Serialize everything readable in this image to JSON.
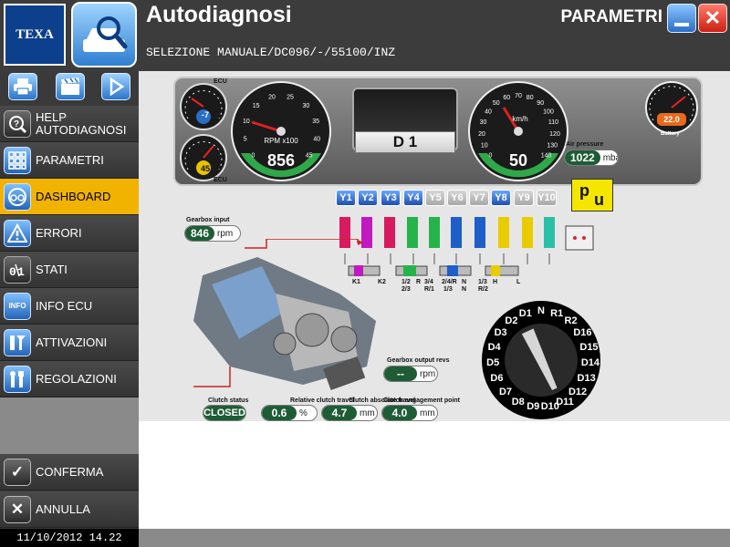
{
  "header": {
    "brand": "TEXA",
    "title": "Autodiagnosi",
    "path": "SELEZIONE MANUALE/DC096/-/55100/INZ",
    "section": "PARAMETRI"
  },
  "sidebar": {
    "toolbar": [
      "printer-icon",
      "clapper-icon",
      "play-icon"
    ],
    "items": [
      {
        "line1": "HELP",
        "line2": "AUTODIAGNOSI",
        "icon": "help-icon"
      },
      {
        "label": "PARAMETRI",
        "icon": "grid-icon"
      },
      {
        "label": "DASHBOARD",
        "icon": "dashboard-icon",
        "active": true
      },
      {
        "label": "ERRORI",
        "icon": "warning-icon"
      },
      {
        "label": "STATI",
        "icon": "switch-icon"
      },
      {
        "label": "INFO ECU",
        "icon": "info-icon",
        "badge": "INFO"
      },
      {
        "label": "ATTIVAZIONI",
        "icon": "activation-icon"
      },
      {
        "label": "REGOLAZIONI",
        "icon": "tools-icon"
      }
    ],
    "confirm": "CONFERMA",
    "cancel": "ANNULLA",
    "datetime": "11/10/2012 14.22"
  },
  "colors": {
    "active": "#f2b200",
    "accent_blue": "#2a6ec8",
    "value_green": "#1e5c36",
    "close_red": "#cc1f12"
  },
  "dashboard": {
    "small_gauge_top": {
      "label": "ECU",
      "value": "-7"
    },
    "small_gauge_bottom": {
      "label": "ECU",
      "value": "45"
    },
    "rpm": {
      "value": "856",
      "unit": "RPM x100",
      "ticks": [
        "0",
        "5",
        "10",
        "15",
        "20",
        "25",
        "30",
        "35",
        "40",
        "45"
      ]
    },
    "gear": "D 1",
    "speed": {
      "value": "50",
      "unit": "km/h",
      "ticks": [
        "0",
        "10",
        "20",
        "30",
        "40",
        "50",
        "60",
        "70",
        "80",
        "90",
        "100",
        "110",
        "120",
        "130",
        "140"
      ]
    },
    "battery": {
      "value": "22.0",
      "label": "Battery"
    },
    "air_pressure": {
      "label": "Air pressure",
      "value": "1022",
      "unit": "mbar"
    },
    "valves": [
      {
        "label": "Y1",
        "on": true
      },
      {
        "label": "Y2",
        "on": true
      },
      {
        "label": "Y3",
        "on": true
      },
      {
        "label": "Y4",
        "on": true
      },
      {
        "label": "Y5",
        "on": false
      },
      {
        "label": "Y6",
        "on": false
      },
      {
        "label": "Y7",
        "on": false
      },
      {
        "label": "Y8",
        "on": true
      },
      {
        "label": "Y9",
        "on": false
      },
      {
        "label": "Y10",
        "on": false
      }
    ],
    "pu": {
      "p": "p",
      "u": "u"
    },
    "gearbox_input": {
      "label": "Gearbox input",
      "value": "846",
      "unit": "rpm"
    },
    "circuit_labels": [
      "K1",
      "K2",
      "1/2",
      "2/3",
      "R",
      "3/4",
      "R/1",
      "2/4/R",
      "1/3",
      "N",
      "N",
      "1/3",
      "R/2",
      "H",
      "L"
    ],
    "gearbox_output": {
      "label": "Gearbox output revs",
      "value": "--",
      "unit": "rpm"
    },
    "clutch_status": {
      "label": "Clutch status",
      "value": "CLOSED"
    },
    "relative_clutch_travel": {
      "label": "Relative clutch travel",
      "value": "0.6",
      "unit": "%"
    },
    "clutch_absolute_travel": {
      "label": "Clutch absolute travel",
      "value": "4.7",
      "unit": "mm"
    },
    "clutch_engagement_point": {
      "label": "Clutch engagement point",
      "value": "4.0",
      "unit": "mm"
    },
    "selector_positions": [
      "N",
      "R1",
      "R2",
      "D16",
      "D15",
      "D14",
      "D13",
      "D12",
      "D11",
      "D10",
      "D9",
      "D8",
      "D7",
      "D6",
      "D5",
      "D4",
      "D3",
      "D2",
      "D1"
    ]
  }
}
